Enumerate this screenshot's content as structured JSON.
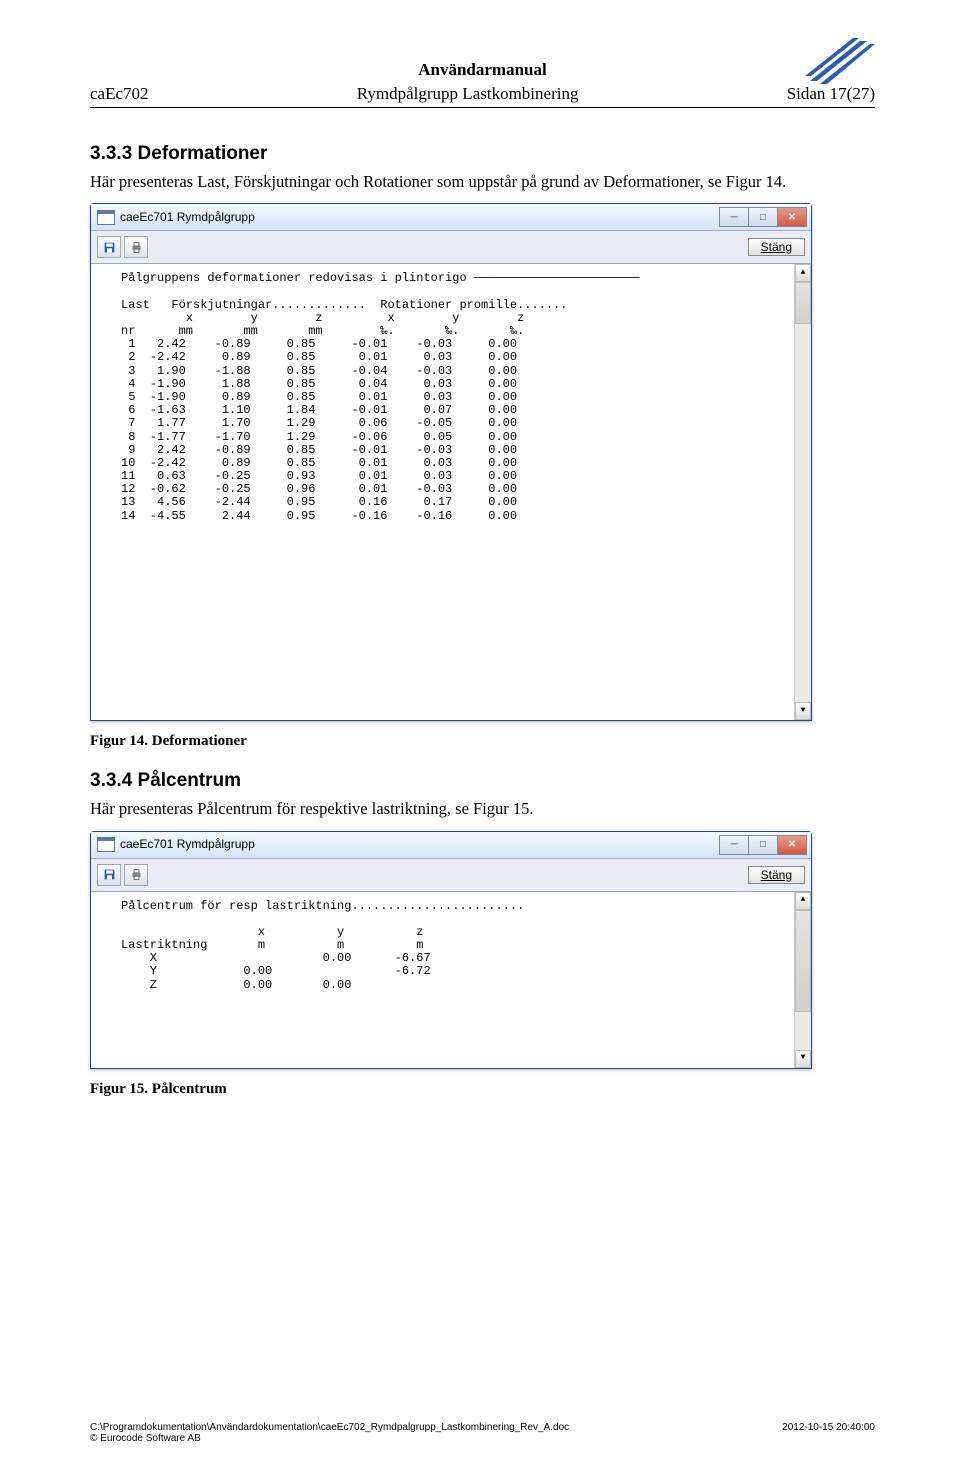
{
  "header": {
    "top": "Användarmanual",
    "left": "caEc702",
    "center": "Rymdpålgrupp Lastkombinering",
    "right": "Sidan 17(27)"
  },
  "section1": {
    "heading": "3.3.3  Deformationer",
    "text": "Här presenteras Last, Förskjutningar och Rotationer som uppstår på grund av Deformationer, se Figur 14.",
    "caption": "Figur 14. Deformationer"
  },
  "section2": {
    "heading": "3.3.4  Pålcentrum",
    "text": "Här presenteras Pålcentrum för respektive lastriktning, se Figur 15.",
    "caption": "Figur 15. Pålcentrum"
  },
  "win": {
    "title": "caeEc701 Rymdpålgrupp",
    "stang": "Stäng"
  },
  "deform": {
    "line1": "Pålgruppens deformationer redovisas i plintorigo ───────────────────────",
    "hdr1": "Last   Förskjutningar.............  Rotationer promille.......",
    "hdr2": "         x        y        z         x        y        z",
    "hdr3": "nr      mm       mm       mm        ‰.       ‰.       ‰.",
    "rows": [
      " 1   2.42    -0.89     0.85     -0.01    -0.03     0.00",
      " 2  -2.42     0.89     0.85      0.01     0.03     0.00",
      " 3   1.90    -1.88     0.85     -0.04    -0.03     0.00",
      " 4  -1.90     1.88     0.85      0.04     0.03     0.00",
      " 5  -1.90     0.89     0.85      0.01     0.03     0.00",
      " 6  -1.63     1.10     1.84     -0.01     0.07     0.00",
      " 7   1.77     1.70     1.29      0.06    -0.05     0.00",
      " 8  -1.77    -1.70     1.29     -0.06     0.05     0.00",
      " 9   2.42    -0.89     0.85     -0.01    -0.03     0.00",
      "10  -2.42     0.89     0.85      0.01     0.03     0.00",
      "11   0.63    -0.25     0.93      0.01     0.03     0.00",
      "12  -0.62    -0.25     0.96      0.01    -0.03     0.00",
      "13   4.56    -2.44     0.95      0.16     0.17     0.00",
      "14  -4.55     2.44     0.95     -0.16    -0.16     0.00"
    ]
  },
  "palcentrum": {
    "line1": "Pålcentrum för resp lastriktning........................",
    "hdr1": "                   x          y          z",
    "hdr2": "Lastriktning       m          m          m",
    "rows": [
      "    X                       0.00      -6.67",
      "    Y            0.00                 -6.72",
      "    Z            0.00       0.00"
    ]
  },
  "footer": {
    "path": "C:\\Programdokumentation\\Användardokumentation\\caeEc702_Rymdpalgrupp_Lastkombinering_Rev_A.doc",
    "copyright": "© Eurocode Software AB",
    "date": "2012-10-15 20:40:00"
  }
}
